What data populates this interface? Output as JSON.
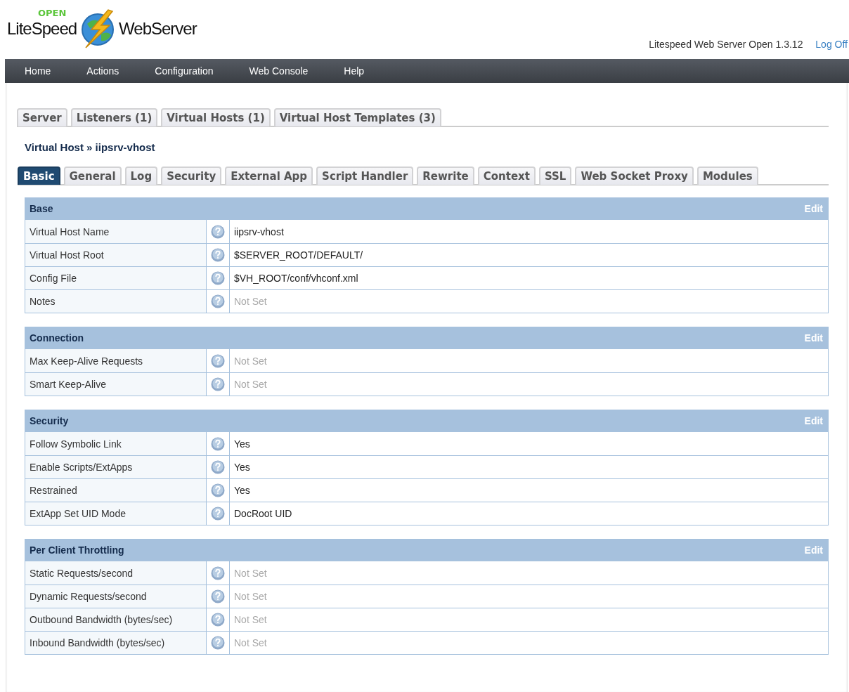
{
  "header": {
    "logo": {
      "badge": "OPEN",
      "left": "LiteSpeed",
      "right": "WebServer"
    },
    "version": "Litespeed Web Server Open 1.3.12",
    "logoff": "Log Off"
  },
  "nav": [
    "Home",
    "Actions",
    "Configuration",
    "Web Console",
    "Help"
  ],
  "top_tabs": [
    {
      "label": "Server",
      "selected": false
    },
    {
      "label": "Listeners (1)",
      "selected": false
    },
    {
      "label": "Virtual Hosts (1)",
      "selected": false
    },
    {
      "label": "Virtual Host Templates (3)",
      "selected": false
    }
  ],
  "breadcrumb": "Virtual Host » iipsrv-vhost",
  "tabs": [
    {
      "label": "Basic",
      "selected": true
    },
    {
      "label": "General",
      "selected": false
    },
    {
      "label": "Log",
      "selected": false
    },
    {
      "label": "Security",
      "selected": false
    },
    {
      "label": "External App",
      "selected": false
    },
    {
      "label": "Script Handler",
      "selected": false
    },
    {
      "label": "Rewrite",
      "selected": false
    },
    {
      "label": "Context",
      "selected": false
    },
    {
      "label": "SSL",
      "selected": false
    },
    {
      "label": "Web Socket Proxy",
      "selected": false
    },
    {
      "label": "Modules",
      "selected": false
    }
  ],
  "sections": [
    {
      "title": "Base",
      "action": "Edit",
      "rows": [
        {
          "label": "Virtual Host Name",
          "value": "iipsrv-vhost",
          "unset": false
        },
        {
          "label": "Virtual Host Root",
          "value": "$SERVER_ROOT/DEFAULT/",
          "unset": false
        },
        {
          "label": "Config File",
          "value": "$VH_ROOT/conf/vhconf.xml",
          "unset": false
        },
        {
          "label": "Notes",
          "value": "Not Set",
          "unset": true
        }
      ]
    },
    {
      "title": "Connection",
      "action": "Edit",
      "rows": [
        {
          "label": "Max Keep-Alive Requests",
          "value": "Not Set",
          "unset": true
        },
        {
          "label": "Smart Keep-Alive",
          "value": "Not Set",
          "unset": true
        }
      ]
    },
    {
      "title": "Security",
      "action": "Edit",
      "rows": [
        {
          "label": "Follow Symbolic Link",
          "value": "Yes",
          "unset": false
        },
        {
          "label": "Enable Scripts/ExtApps",
          "value": "Yes",
          "unset": false
        },
        {
          "label": "Restrained",
          "value": "Yes",
          "unset": false
        },
        {
          "label": "ExtApp Set UID Mode",
          "value": "DocRoot UID",
          "unset": false
        }
      ]
    },
    {
      "title": "Per Client Throttling",
      "action": "Edit",
      "rows": [
        {
          "label": "Static Requests/second",
          "value": "Not Set",
          "unset": true
        },
        {
          "label": "Dynamic Requests/second",
          "value": "Not Set",
          "unset": true
        },
        {
          "label": "Outbound Bandwidth (bytes/sec)",
          "value": "Not Set",
          "unset": true
        },
        {
          "label": "Inbound Bandwidth (bytes/sec)",
          "value": "Not Set",
          "unset": true
        }
      ]
    }
  ]
}
